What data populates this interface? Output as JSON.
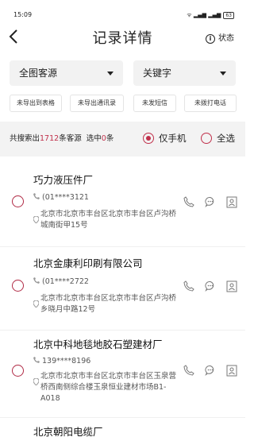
{
  "status_bar": {
    "time": "15:09",
    "signal_text": "ᯤ ▂▄▆ ▂▄▆",
    "battery": "63"
  },
  "header": {
    "back_icon": "back-arrow-icon",
    "title": "记录详情",
    "status_label": "状态"
  },
  "dropdowns": [
    {
      "label": "全图客源"
    },
    {
      "label": "关键字"
    }
  ],
  "filters": [
    {
      "label": "未导出到表格"
    },
    {
      "label": "未导出通讯录"
    },
    {
      "label": "未发短信"
    },
    {
      "label": "未拨打电话"
    }
  ],
  "summary": {
    "prefix": "共搜索出",
    "count": "1712",
    "suffix": "条客源",
    "selected_prefix": "选中",
    "selected_count": "0",
    "selected_suffix": "条",
    "option_phone_only": "仅手机",
    "option_select_all": "全选"
  },
  "accent_color": "#c0304b",
  "records": [
    {
      "name": "巧力液压件厂",
      "phone": "(01****3121",
      "address": "北京市北京市丰台区北京市丰台区卢沟桥城南街甲15号"
    },
    {
      "name": "北京金康利印刷有限公司",
      "phone": "(01****2722",
      "address": "北京市北京市丰台区北京市丰台区卢沟桥乡晓月中路12号"
    },
    {
      "name": "北京中科地毯地胶石塑建材厂",
      "phone": "139****8196",
      "address": "北京市北京市丰台区北京市丰台区玉泉营桥西南侧综合楼玉泉恒业建材市场B1-A018"
    },
    {
      "name": "北京朝阳电缆厂"
    }
  ]
}
